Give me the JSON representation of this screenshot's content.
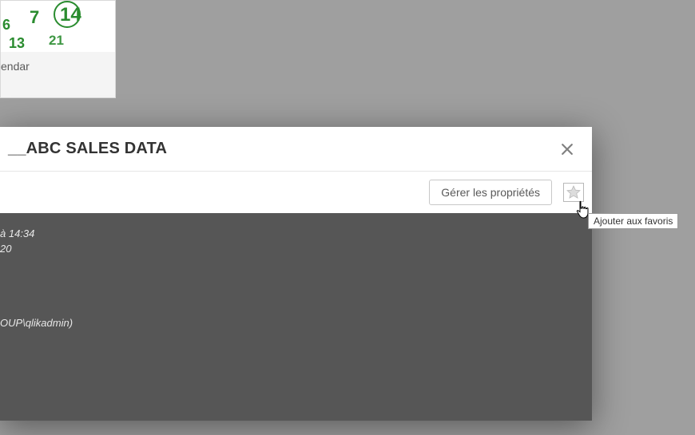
{
  "background": {
    "card_label": "endar",
    "thumb_numbers": {
      "n6": "6",
      "n7": "7",
      "n14": "14",
      "n13": "13",
      "n21": "21"
    }
  },
  "modal": {
    "title": "__ABC SALES DATA",
    "manage_properties_label": "Gérer les propriétés",
    "favorite_tooltip": "Ajouter aux favoris",
    "details": {
      "time_line": "à 14:34",
      "num_line": "20",
      "owner_line": "OUP\\qlikadmin)"
    }
  }
}
